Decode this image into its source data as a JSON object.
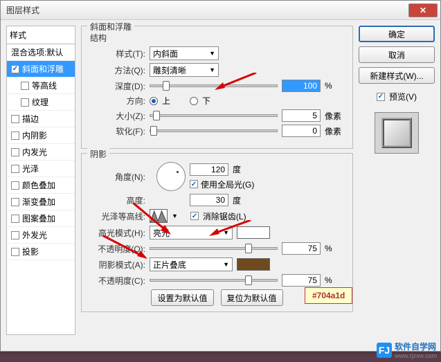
{
  "dialog": {
    "title": "图层样式"
  },
  "styles": {
    "header": "样式",
    "blend": "混合选项:默认",
    "items": [
      {
        "label": "斜面和浮雕",
        "checked": true,
        "selected": true
      },
      {
        "label": "等高线",
        "checked": false,
        "indent": true
      },
      {
        "label": "纹理",
        "checked": false,
        "indent": true
      },
      {
        "label": "描边",
        "checked": false
      },
      {
        "label": "内阴影",
        "checked": false
      },
      {
        "label": "内发光",
        "checked": false
      },
      {
        "label": "光泽",
        "checked": false
      },
      {
        "label": "颜色叠加",
        "checked": false
      },
      {
        "label": "渐变叠加",
        "checked": false
      },
      {
        "label": "图案叠加",
        "checked": false
      },
      {
        "label": "外发光",
        "checked": false
      },
      {
        "label": "投影",
        "checked": false
      }
    ]
  },
  "bevel": {
    "title": "斜面和浮雕",
    "structure": {
      "title": "结构",
      "style_label": "样式(T):",
      "style_value": "内斜面",
      "method_label": "方法(Q):",
      "method_value": "雕刻清晰",
      "depth_label": "深度(D):",
      "depth_value": "100",
      "depth_unit": "%",
      "direction_label": "方向:",
      "up": "上",
      "down": "下",
      "size_label": "大小(Z):",
      "size_value": "5",
      "size_unit": "像素",
      "soften_label": "软化(F):",
      "soften_value": "0",
      "soften_unit": "像素"
    },
    "shading": {
      "title": "阴影",
      "angle_label": "角度(N):",
      "angle_value": "120",
      "angle_unit": "度",
      "global_label": "使用全局光(G)",
      "alt_label": "高度:",
      "alt_value": "30",
      "alt_unit": "度",
      "gloss_label": "光泽等高线:",
      "antialias": "消除锯齿(L)",
      "hi_mode_label": "高光模式(H):",
      "hi_mode_value": "亮光",
      "hi_color": "#ffffff",
      "hi_opacity_label": "不透明度(O):",
      "hi_opacity_value": "75",
      "hi_opacity_unit": "%",
      "sh_mode_label": "阴影模式(A):",
      "sh_mode_value": "正片叠底",
      "sh_color": "#704a1d",
      "sh_opacity_label": "不透明度(C):",
      "sh_opacity_value": "75",
      "sh_opacity_unit": "%"
    },
    "buttons": {
      "default": "设置为默认值",
      "reset": "复位为默认值"
    }
  },
  "right": {
    "ok": "确定",
    "cancel": "取消",
    "newstyle": "新建样式(W)...",
    "preview_label": "预览(V)"
  },
  "annotation": {
    "color_hex": "#704a1d"
  },
  "watermark": {
    "text": "软件自学网",
    "url": "www.rjzxw.com",
    "icon": "FJ"
  }
}
